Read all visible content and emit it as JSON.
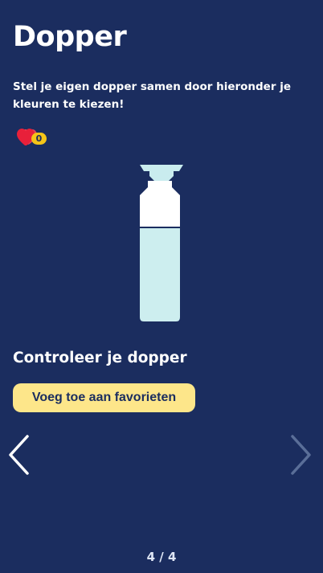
{
  "header": {
    "title": "Dopper",
    "intro": "Stel je eigen dopper samen door hieronder je kleuren te kiezen!"
  },
  "favorites": {
    "count": "0",
    "icon": "hearts-icon",
    "colors": {
      "heart_back": "#e0455b",
      "heart_front": "#e8203a",
      "badge": "#f5c518"
    }
  },
  "bottle": {
    "colors": {
      "cap": "#c9ecee",
      "top": "#ffffff",
      "body": "#cdeeef"
    }
  },
  "review": {
    "heading": "Controleer je dopper",
    "button_label": "Voeg toe aan favorieten"
  },
  "navigation": {
    "prev_icon": "chevron-left-icon",
    "next_icon": "chevron-right-icon",
    "pager": "4 / 4"
  },
  "colors": {
    "background": "#1b2d5f",
    "button": "#fde68a",
    "text": "#ffffff"
  }
}
